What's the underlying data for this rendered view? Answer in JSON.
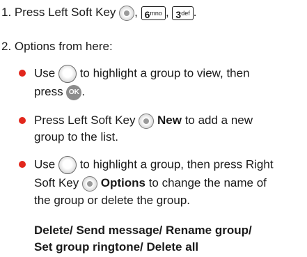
{
  "step1": {
    "prefix": "1. Press Left Soft Key",
    "key1_digit": "6",
    "key1_letters": "mno",
    "key2_digit": "3",
    "key2_letters": "def",
    "sep": ",",
    "end": "."
  },
  "step2": {
    "intro": "2. Options from here:",
    "bullet1": {
      "part1": "Use",
      "part2": "to highlight a group to view, then",
      "part3": "press",
      "part4": ".",
      "ok_label": "OK"
    },
    "bullet2": {
      "part1": "Press Left Soft Key",
      "bold": "New",
      "part2": "to add a new",
      "part3": "group to the list."
    },
    "bullet3": {
      "part1": "Use",
      "part2": "to highlight a group, then press Right",
      "part3": "Soft Key",
      "bold": "Options",
      "part4": "to change the name of",
      "part5": "the group or delete the group."
    },
    "options_line1": "Delete/ Send message/ Rename group/",
    "options_line2": "Set group ringtone/ Delete all"
  },
  "colors": {
    "bullet": "#e2271c",
    "text": "#1a1a1a"
  }
}
